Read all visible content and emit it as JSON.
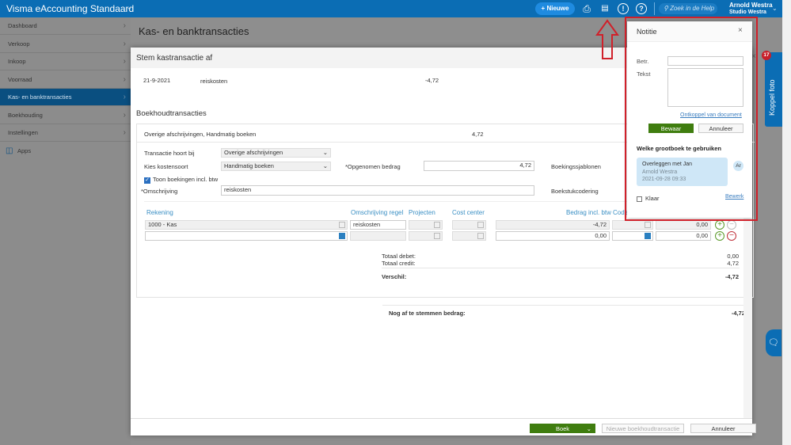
{
  "app": {
    "title": "Visma eAccounting Standaard",
    "new_label": "+ Nieuwe",
    "search_placeholder": "Zoek in de Help",
    "user_name": "Arnold Westra",
    "company": "Studio Westra"
  },
  "sidebar": {
    "items": [
      {
        "label": "Dashboard"
      },
      {
        "label": "Verkoop"
      },
      {
        "label": "Inkoop"
      },
      {
        "label": "Voorraad"
      },
      {
        "label": "Kas- en banktransacties"
      },
      {
        "label": "Boekhouding"
      },
      {
        "label": "Instellingen"
      }
    ],
    "apps": "Apps"
  },
  "page": {
    "title": "Kas- en banktransacties"
  },
  "modal": {
    "title": "Stem kastransactie af",
    "tx": {
      "date": "21-9-2021",
      "desc": "reiskosten",
      "amount": "-4,72"
    },
    "section": "Boekhoudtransacties",
    "summary": {
      "label": "Overige afschrijvingen, Handmatig boeken",
      "amount": "4,72"
    },
    "form": {
      "transactie_label": "Transactie hoort bij",
      "transactie_value": "Overige afschrijvingen",
      "kosten_label": "Kies kostensoort",
      "kosten_value": "Handmatig boeken",
      "opgenomen_label": "*Opgenomen bedrag",
      "opgenomen_value": "4,72",
      "sjablonen_label": "Boekingssjablonen",
      "toon_label": "Toon boekingen incl. btw",
      "omschrijving_label": "*Omschrijving",
      "omschrijving_value": "reiskosten",
      "codering_label": "Boekstukcodering"
    },
    "columns": [
      "Rekening",
      "Omschrijving regel",
      "Projecten",
      "Cost center",
      "Bedrag incl. btw",
      "Code"
    ],
    "rows": [
      {
        "rekening": "1000 - Kas",
        "omschrijving": "reiskosten",
        "bedrag": "-4,72",
        "btw": "0,00"
      },
      {
        "rekening": "",
        "omschrijving": "",
        "bedrag": "0,00",
        "btw": "0,00"
      }
    ],
    "totals": {
      "debet_label": "Totaal debet:",
      "debet": "0,00",
      "credit_label": "Totaal credit:",
      "credit": "4,72",
      "verschil_label": "Verschil:",
      "verschil": "-4,72"
    },
    "remaining": {
      "label": "Nog af te stemmen bedrag:",
      "value": "-4,72"
    },
    "footer": {
      "boek": "Boek",
      "nieuwe": "Nieuwe boekhoudtransactie",
      "annuleer": "Annuleer"
    }
  },
  "note": {
    "title": "Notitie",
    "betr_label": "Betr.",
    "tekst_label": "Tekst",
    "ontkoppel": "Ontkoppel van document",
    "bewaar": "Bewaar",
    "annuleer": "Annuleer",
    "heading": "Welke grootboek te gebruiken",
    "comment": {
      "text": "Overleggen met Jan",
      "author": "Arnold Westra",
      "time": "2021-09-28 09:33",
      "initials": "Ar"
    },
    "klaar": "Klaar",
    "bewerk": "Bewerk"
  },
  "right": {
    "koppel": "Koppel foto",
    "badge": "17"
  },
  "colors": {
    "brand": "#0b6db4",
    "green": "#3f7d0f",
    "highlight": "#d0202a"
  }
}
